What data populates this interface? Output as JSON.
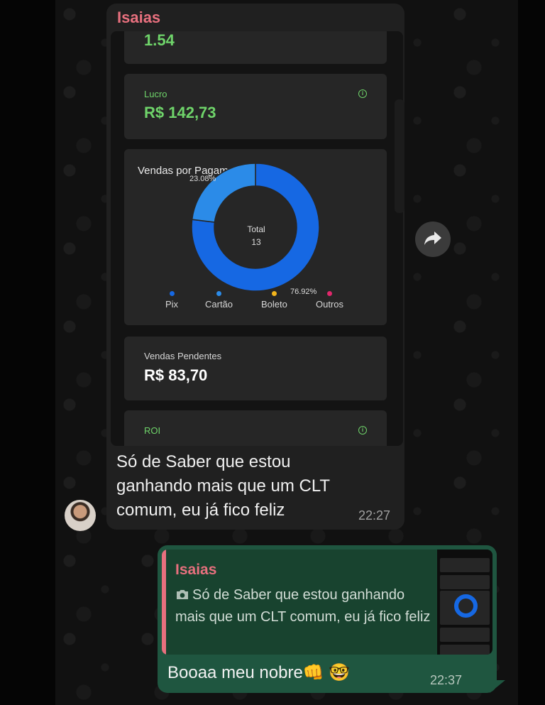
{
  "incoming": {
    "sender": "Isaias",
    "screenshot": {
      "top_value": "1.54",
      "lucro": {
        "label": "Lucro",
        "value": "R$ 142,73"
      },
      "chart_title": "Vendas por Pagamento",
      "center_label": "Total",
      "center_value": "13",
      "pct_top": "23.08%",
      "pct_bottom": "76.92%",
      "legend": [
        "Pix",
        "Cartão",
        "Boleto",
        "Outros"
      ],
      "legend_colors": [
        "#1668e3",
        "#2b8be8",
        "#f3b51c",
        "#e0276b"
      ],
      "pendentes": {
        "label": "Vendas Pendentes",
        "value": "R$ 83,70"
      },
      "roi_label": "ROI"
    },
    "text": "Só de Saber que estou ganhando mais que um CLT comum, eu já fico feliz",
    "time": "22:27"
  },
  "outgoing": {
    "quote_name": "Isaias",
    "quote_text": "Só de Saber que estou ganhando mais que um CLT comum, eu já fico feliz",
    "text": "Booaa meu nobre👊 🤓",
    "time": "22:37"
  },
  "chart_data": {
    "type": "pie",
    "title": "Vendas por Pagamento",
    "categories": [
      "Pix",
      "Cartão",
      "Boleto",
      "Outros"
    ],
    "values": [
      76.92,
      23.08,
      0,
      0
    ],
    "colors": [
      "#1668e3",
      "#2b8be8",
      "#f3b51c",
      "#e0276b"
    ],
    "legend": "bottom"
  }
}
